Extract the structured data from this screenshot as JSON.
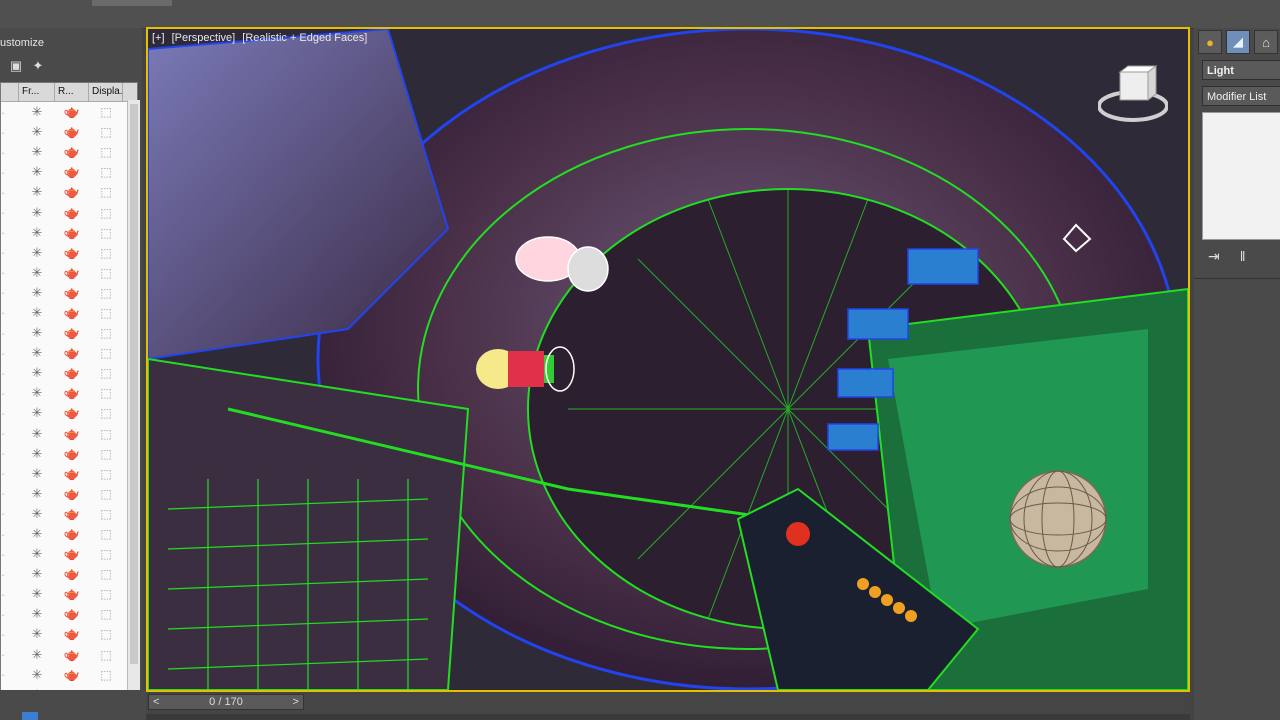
{
  "explorer": {
    "title": "ustomize",
    "columns": [
      "",
      "Fr...",
      "R...",
      "Displa..."
    ],
    "row_count": 30,
    "row_icons": {
      "c0": "·",
      "c1": "✳",
      "c2": "🫖",
      "c3": "⬚"
    }
  },
  "viewport": {
    "label_plus": "[+]",
    "label_view": "[Perspective]",
    "label_shading": "[Realistic + Edged Faces]"
  },
  "command_panel": {
    "category": "Light",
    "modifier_list": "Modifier List"
  },
  "timeline": {
    "frame_readout": "0 / 170",
    "prev": "<",
    "next": ">"
  },
  "colors": {
    "viewport_border": "#e5c000",
    "wire_green": "#22dd22",
    "wire_blue": "#2244ee",
    "active_tab": "#6f8fb8"
  }
}
